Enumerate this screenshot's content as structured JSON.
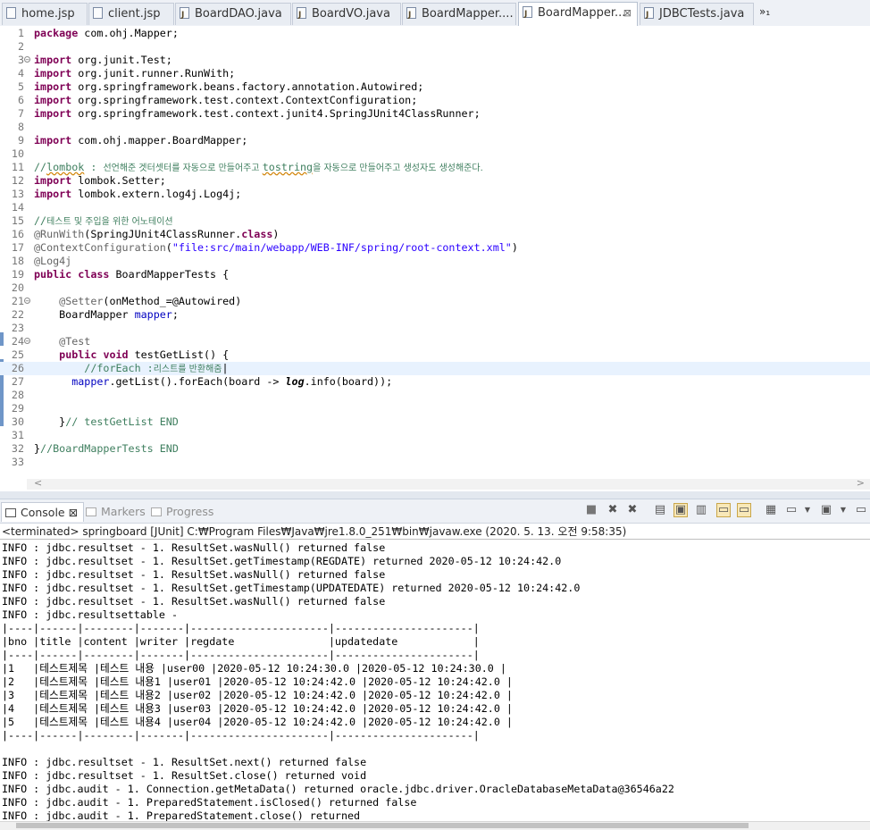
{
  "editor_tabs": [
    {
      "label": "home.jsp",
      "active": false
    },
    {
      "label": "client.jsp",
      "active": false
    },
    {
      "label": "BoardDAO.java",
      "active": false
    },
    {
      "label": "BoardVO.java",
      "active": false
    },
    {
      "label": "BoardMapper....",
      "active": false
    },
    {
      "label": "BoardMapper...",
      "active": true
    },
    {
      "label": "JDBCTests.java",
      "active": false
    }
  ],
  "overflow_label": "»₁",
  "code_lines": [
    {
      "n": "1",
      "t": "package com.ohj.Mapper;"
    },
    {
      "n": "2",
      "t": ""
    },
    {
      "n": "3",
      "t": "import org.junit.Test;"
    },
    {
      "n": "4",
      "t": "import org.junit.runner.RunWith;"
    },
    {
      "n": "5",
      "t": "import org.springframework.beans.factory.annotation.Autowired;"
    },
    {
      "n": "6",
      "t": "import org.springframework.test.context.ContextConfiguration;"
    },
    {
      "n": "7",
      "t": "import org.springframework.test.context.junit4.SpringJUnit4ClassRunner;"
    },
    {
      "n": "8",
      "t": ""
    },
    {
      "n": "9",
      "t": "import com.ohj.mapper.BoardMapper;"
    },
    {
      "n": "10",
      "t": ""
    },
    {
      "n": "11",
      "t": "//lombok : 선언해준 겟터셋터를 자동으로 만들어주고 tostring을 자동으로 만들어주고 생성자도 생성해준다."
    },
    {
      "n": "12",
      "t": "import lombok.Setter;"
    },
    {
      "n": "13",
      "t": "import lombok.extern.log4j.Log4j;"
    },
    {
      "n": "14",
      "t": ""
    },
    {
      "n": "15",
      "t": "//테스트 및 주입을 위한 어노테이션"
    },
    {
      "n": "16",
      "t": "@RunWith(SpringJUnit4ClassRunner.class)"
    },
    {
      "n": "17",
      "t": "@ContextConfiguration(\"file:src/main/webapp/WEB-INF/spring/root-context.xml\")"
    },
    {
      "n": "18",
      "t": "@Log4j"
    },
    {
      "n": "19",
      "t": "public class BoardMapperTests {"
    },
    {
      "n": "20",
      "t": ""
    },
    {
      "n": "21",
      "t": "    @Setter(onMethod_=@Autowired)"
    },
    {
      "n": "22",
      "t": "    BoardMapper mapper;"
    },
    {
      "n": "23",
      "t": ""
    },
    {
      "n": "24",
      "t": "    @Test"
    },
    {
      "n": "25",
      "t": "    public void testGetList() {"
    },
    {
      "n": "26",
      "t": "        //forEach :리스트를 반환해줌"
    },
    {
      "n": "27",
      "t": "      mapper.getList().forEach(board -> log.info(board));"
    },
    {
      "n": "28",
      "t": ""
    },
    {
      "n": "29",
      "t": ""
    },
    {
      "n": "30",
      "t": "    }// testGetList END"
    },
    {
      "n": "31",
      "t": ""
    },
    {
      "n": "32",
      "t": "}//BoardMapperTests END"
    },
    {
      "n": "33",
      "t": ""
    }
  ],
  "console_tabs": [
    {
      "label": "Console",
      "close": "⊠",
      "active": true
    },
    {
      "label": "Markers",
      "active": false
    },
    {
      "label": "Progress",
      "active": false
    }
  ],
  "console_status": "<terminated> springboard [JUnit] C:₩Program Files₩Java₩jre1.8.0_251₩bin₩javaw.exe (2020. 5. 13. 오전 9:58:35)",
  "console_lines": [
    "INFO : jdbc.resultset - 1. ResultSet.wasNull() returned false",
    "INFO : jdbc.resultset - 1. ResultSet.getTimestamp(REGDATE) returned 2020-05-12 10:24:42.0",
    "INFO : jdbc.resultset - 1. ResultSet.wasNull() returned false",
    "INFO : jdbc.resultset - 1. ResultSet.getTimestamp(UPDATEDATE) returned 2020-05-12 10:24:42.0",
    "INFO : jdbc.resultset - 1. ResultSet.wasNull() returned false",
    "INFO : jdbc.resultsettable -",
    "|----|------|--------|-------|----------------------|----------------------|",
    "|bno |title |content |writer |regdate               |updatedate            |",
    "|----|------|--------|-------|----------------------|----------------------|",
    "|1   |테스트제목 |테스트 내용 |user00 |2020-05-12 10:24:30.0 |2020-05-12 10:24:30.0 |",
    "|2   |테스트제목 |테스트 내용1 |user01 |2020-05-12 10:24:42.0 |2020-05-12 10:24:42.0 |",
    "|3   |테스트제목 |테스트 내용2 |user02 |2020-05-12 10:24:42.0 |2020-05-12 10:24:42.0 |",
    "|4   |테스트제목 |테스트 내용3 |user03 |2020-05-12 10:24:42.0 |2020-05-12 10:24:42.0 |",
    "|5   |테스트제목 |테스트 내용4 |user04 |2020-05-12 10:24:42.0 |2020-05-12 10:24:42.0 |",
    "|----|------|--------|-------|----------------------|----------------------|",
    "",
    "INFO : jdbc.resultset - 1. ResultSet.next() returned false",
    "INFO : jdbc.resultset - 1. ResultSet.close() returned void",
    "INFO : jdbc.audit - 1. Connection.getMetaData() returned oracle.jdbc.driver.OracleDatabaseMetaData@36546a22",
    "INFO : jdbc.audit - 1. PreparedStatement.isClosed() returned false",
    "INFO : jdbc.audit - 1. PreparedStatement.close() returned"
  ],
  "toolbar_icons": [
    "terminate-icon",
    "remove-launch-icon",
    "remove-all-terminated-icon",
    "clear-console-icon",
    "scroll-lock-icon",
    "word-wrap-icon",
    "show-on-stdout-icon",
    "show-on-stderr-icon",
    "pin-console-icon",
    "display-selected-console-icon",
    "open-console-icon"
  ],
  "colors": {
    "keyword": "#7f0055",
    "string": "#2a00ff",
    "comment": "#3f7f5f",
    "annotation": "#646464",
    "field": "#0000c0",
    "current_line": "#e8f2fe"
  }
}
